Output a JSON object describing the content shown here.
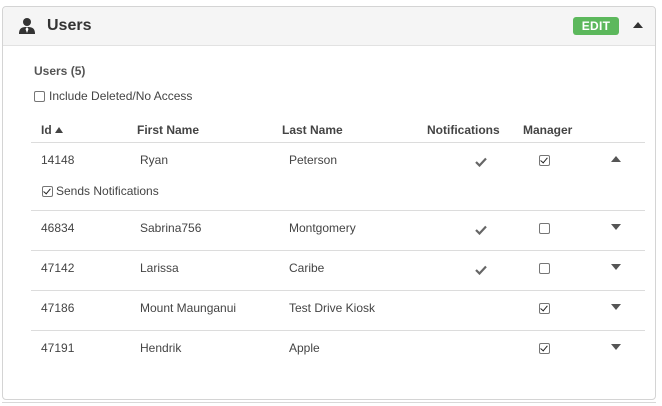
{
  "panel": {
    "title": "Users",
    "edit_label": "EDIT",
    "user_icon": "user-icon",
    "edit_color": "#5cb85c"
  },
  "users_section": {
    "count_label": "Users (5)",
    "include_deleted_label": "Include Deleted/No Access",
    "include_deleted_checked": false
  },
  "table": {
    "columns": [
      "Id",
      "First Name",
      "Last Name",
      "Notifications",
      "Manager"
    ],
    "sort_column": "Id",
    "sort_direction": "ascending",
    "rows": [
      {
        "id": "14148",
        "first": "Ryan",
        "last": "Peterson",
        "notifications": true,
        "manager": true,
        "expanded": true,
        "expanded_label": "Sends Notifications",
        "expanded_checked": true
      },
      {
        "id": "46834",
        "first": "Sabrina756",
        "last": "Montgomery",
        "notifications": true,
        "manager": false,
        "expanded": false
      },
      {
        "id": "47142",
        "first": "Larissa",
        "last": "Caribe",
        "notifications": true,
        "manager": false,
        "expanded": false
      },
      {
        "id": "47186",
        "first": "Mount Maunganui",
        "last": "Test Drive Kiosk",
        "notifications": false,
        "manager": true,
        "expanded": false
      },
      {
        "id": "47191",
        "first": "Hendrik",
        "last": "Apple",
        "notifications": false,
        "manager": true,
        "expanded": false
      }
    ]
  }
}
